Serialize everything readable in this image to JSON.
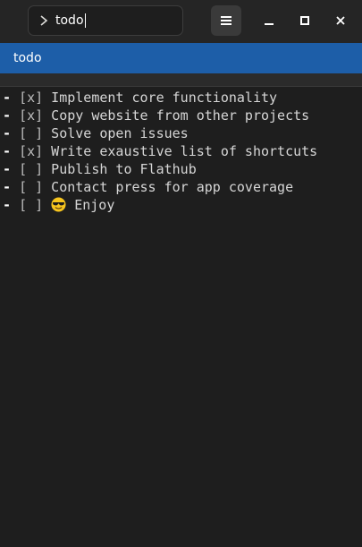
{
  "search": {
    "query": "todo"
  },
  "suggestions": [
    {
      "label": "todo"
    }
  ],
  "items": [
    {
      "prefix": "- ",
      "box": "[x]",
      "text": " Implement core functionality",
      "checked": true
    },
    {
      "prefix": "- ",
      "box": "[x]",
      "text": " Copy website from other projects",
      "checked": true
    },
    {
      "prefix": "- ",
      "box": "[ ]",
      "text": " Solve open issues",
      "checked": false
    },
    {
      "prefix": "- ",
      "box": "[x]",
      "text": " Write exaustive list of shortcuts",
      "checked": true
    },
    {
      "prefix": "- ",
      "box": "[ ]",
      "text": " Publish to Flathub",
      "checked": false
    },
    {
      "prefix": "- ",
      "box": "[ ]",
      "text": " Contact press for app coverage",
      "checked": false
    },
    {
      "prefix": "- ",
      "box": "[ ]",
      "text": "Enjoy",
      "checked": false,
      "emoji": "sunglasses-emoji"
    }
  ],
  "icons": {
    "search": "chevron-right-icon",
    "menu": "hamburger-menu-icon",
    "minimize": "minimize-icon",
    "maximize": "maximize-icon",
    "close": "close-icon"
  },
  "colors": {
    "accent": "#1d5ea8",
    "background": "#1e1e1e",
    "header": "#252525"
  }
}
